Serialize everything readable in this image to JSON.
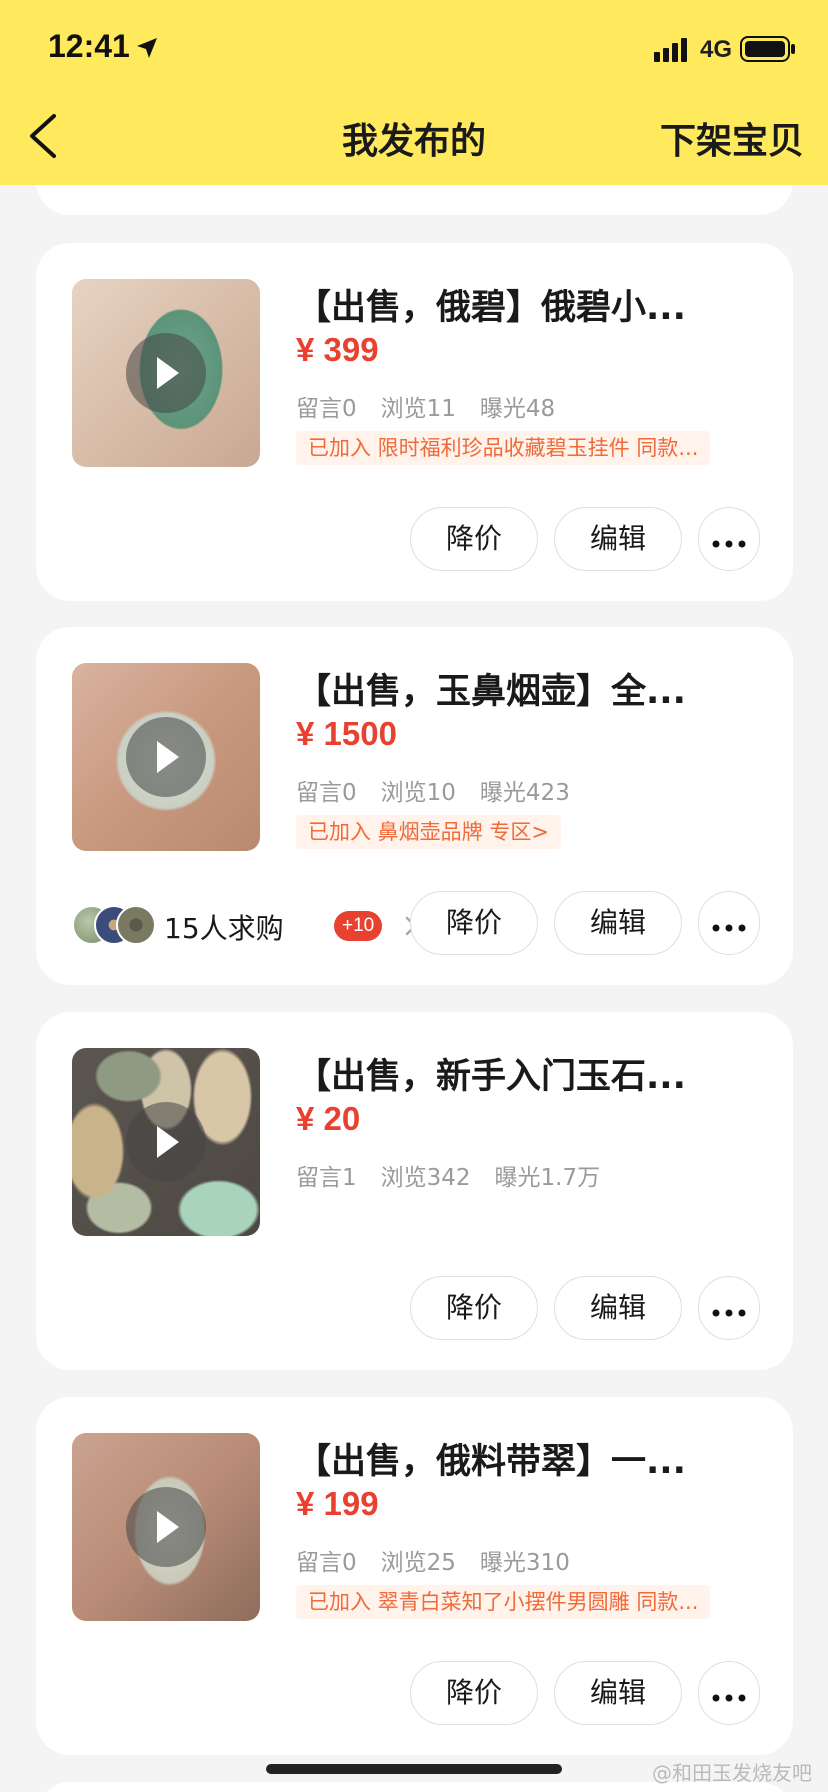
{
  "status_bar": {
    "time": "12:41",
    "network": "4G"
  },
  "header": {
    "title": "我发布的",
    "action": "下架宝贝"
  },
  "items": [
    {
      "title": "【出售，俄碧】俄碧小...",
      "price": "¥ 399",
      "comments": "留言0",
      "views": "浏览11",
      "exposure": "曝光48",
      "tag": "已加入 限时福利珍品收藏碧玉挂件 同款...",
      "btn_price": "降价",
      "btn_edit": "编辑"
    },
    {
      "title": "【出售，玉鼻烟壶】全...",
      "price": "¥ 1500",
      "comments": "留言0",
      "views": "浏览10",
      "exposure": "曝光423",
      "tag": "已加入 鼻烟壶品牌 专区>",
      "buyers_text": "15人求购",
      "buyers_badge": "+10",
      "btn_price": "降价",
      "btn_edit": "编辑"
    },
    {
      "title": "【出售，新手入门玉石...",
      "price": "¥ 20",
      "comments": "留言1",
      "views": "浏览342",
      "exposure": "曝光1.7万",
      "btn_price": "降价",
      "btn_edit": "编辑"
    },
    {
      "title": "【出售，俄料带翠】一...",
      "price": "¥ 199",
      "comments": "留言0",
      "views": "浏览25",
      "exposure": "曝光310",
      "tag": "已加入 翠青白菜知了小摆件男圆雕 同款...",
      "btn_price": "降价",
      "btn_edit": "编辑"
    }
  ],
  "watermark": "@和田玉发烧友吧",
  "colors": {
    "header_bg": "#ffe95c",
    "price": "#e8412f",
    "tag_text": "#f06a3a",
    "tag_bg": "#fff3ec"
  }
}
